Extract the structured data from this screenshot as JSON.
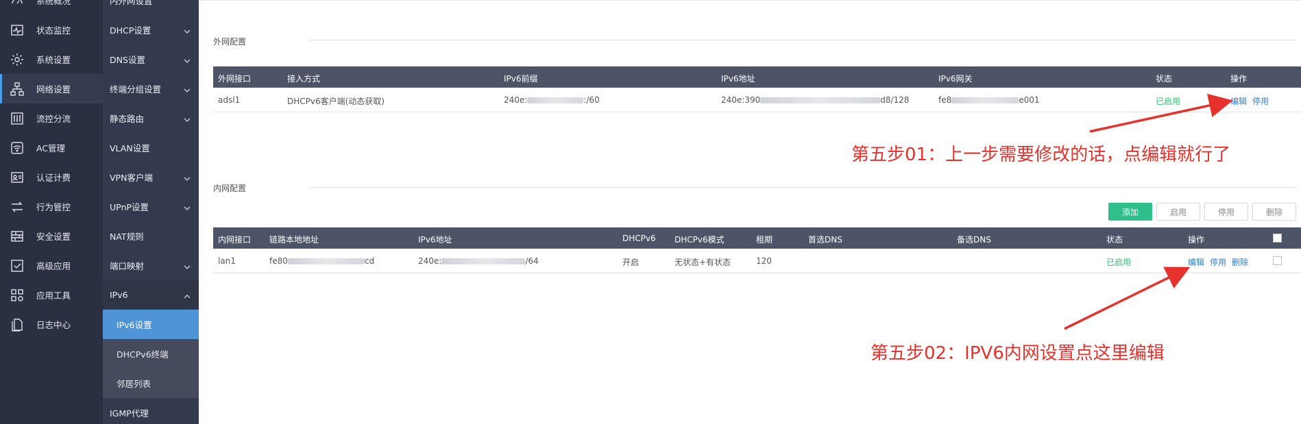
{
  "sidebar": {
    "items": [
      {
        "label": "系统概况",
        "icon": "dashboard-icon"
      },
      {
        "label": "状态监控",
        "icon": "pulse-icon"
      },
      {
        "label": "系统设置",
        "icon": "gear-icon"
      },
      {
        "label": "网络设置",
        "icon": "network-icon"
      },
      {
        "label": "流控分流",
        "icon": "sliders-icon"
      },
      {
        "label": "AC管理",
        "icon": "wifi-icon"
      },
      {
        "label": "认证计费",
        "icon": "id-card-icon"
      },
      {
        "label": "行为管控",
        "icon": "exchange-icon"
      },
      {
        "label": "安全设置",
        "icon": "firewall-icon"
      },
      {
        "label": "高级应用",
        "icon": "check-box-icon"
      },
      {
        "label": "应用工具",
        "icon": "apps-icon"
      },
      {
        "label": "日志中心",
        "icon": "document-icon"
      }
    ]
  },
  "subnav": {
    "items": [
      {
        "label": "内外网设置"
      },
      {
        "label": "DHCP设置"
      },
      {
        "label": "DNS设置"
      },
      {
        "label": "终端分组设置"
      },
      {
        "label": "静态路由"
      },
      {
        "label": "VLAN设置"
      },
      {
        "label": "VPN客户端"
      },
      {
        "label": "UPnP设置"
      },
      {
        "label": "NAT规则"
      },
      {
        "label": "端口映射"
      },
      {
        "label": "IPv6"
      },
      {
        "label": "IPv6设置"
      },
      {
        "label": "DHCPv6终端"
      },
      {
        "label": "邻居列表"
      },
      {
        "label": "IGMP代理"
      }
    ]
  },
  "wan": {
    "section_title": "外网配置",
    "headers": [
      "外网接口",
      "接入方式",
      "IPv6前缀",
      "IPv6地址",
      "IPv6网关",
      "状态",
      "操作"
    ],
    "row": {
      "interface": "adsl1",
      "access": "DHCPv6客户端(动态获取)",
      "prefix_a": "240e:",
      "prefix_b": ":/60",
      "addr_a": "240e:390",
      "addr_b": "d8/128",
      "gw_a": "fe8",
      "gw_b": "e001",
      "status": "已启用",
      "edit": "编辑",
      "disable": "停用"
    }
  },
  "lan": {
    "section_title": "内网配置",
    "toolbar": {
      "add": "添加",
      "enable": "启用",
      "disable": "停用",
      "delete": "删除"
    },
    "headers": [
      "内网接口",
      "链路本地地址",
      "IPv6地址",
      "DHCPv6",
      "DHCPv6模式",
      "租期",
      "首选DNS",
      "备选DNS",
      "状态",
      "操作"
    ],
    "row": {
      "interface": "lan1",
      "link_a": "fe80",
      "link_b": "cd",
      "addr_a": "240e:",
      "addr_b": "/64",
      "dhcpv6": "开启",
      "mode": "无状态+有状态",
      "lease": "120",
      "dns1": "",
      "dns2": "",
      "status": "已启用",
      "edit": "编辑",
      "disable": "停用",
      "delete": "删除"
    }
  },
  "annotations": {
    "step1": "第五步01：上一步需要修改的话，点编辑就行了",
    "step2": "第五步02：IPV6内网设置点这里编辑",
    "color": "#e5322d"
  }
}
